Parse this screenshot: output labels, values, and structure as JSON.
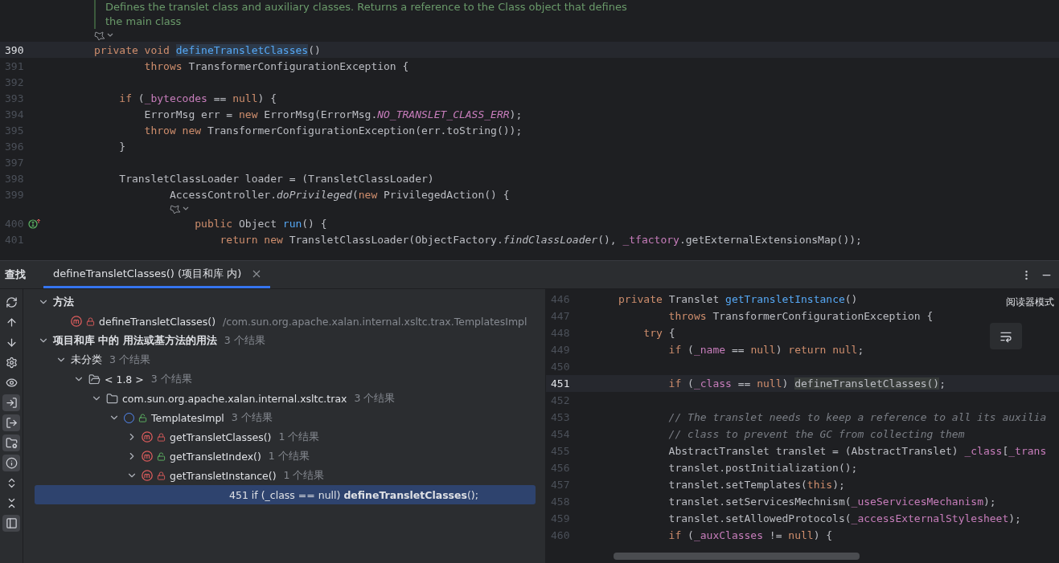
{
  "editor": {
    "doc_comment": [
      "Defines the translet class and auxiliary classes. Returns a reference to the Class object that defines",
      "the main class"
    ],
    "lines": [
      {
        "kind": "fold"
      },
      {
        "kind": "code",
        "number": "390",
        "current": true,
        "segments": [
          {
            "text": "private void ",
            "kind": "kw"
          },
          {
            "text": "defineTransletClasses",
            "kind": "decl"
          },
          {
            "text": "()",
            "kind": "plain"
          }
        ]
      },
      {
        "kind": "code",
        "number": "391",
        "current": false,
        "segments": [
          {
            "text": "        throws ",
            "kind": "kw"
          },
          {
            "text": "TransformerConfigurationException {",
            "kind": "plain"
          }
        ]
      },
      {
        "kind": "code",
        "number": "392",
        "current": false
      },
      {
        "kind": "code",
        "number": "393",
        "current": false,
        "segments": [
          {
            "text": "    if ",
            "kind": "kw"
          },
          {
            "text": "(",
            "kind": "plain"
          },
          {
            "text": "_bytecodes",
            "kind": "field"
          },
          {
            "text": " == ",
            "kind": "plain"
          },
          {
            "text": "null",
            "kind": "kw"
          },
          {
            "text": ") {",
            "kind": "plain"
          }
        ]
      },
      {
        "kind": "code",
        "number": "394",
        "current": false,
        "segments": [
          {
            "text": "        ErrorMsg err = ",
            "kind": "plain"
          },
          {
            "text": "new ",
            "kind": "kw"
          },
          {
            "text": "ErrorMsg(ErrorMsg.",
            "kind": "plain"
          },
          {
            "text": "NO_TRANSLET_CLASS_ERR",
            "kind": "static"
          },
          {
            "text": ");",
            "kind": "plain"
          }
        ]
      },
      {
        "kind": "code",
        "number": "395",
        "current": false,
        "segments": [
          {
            "text": "        throw new ",
            "kind": "kw"
          },
          {
            "text": "TransformerConfigurationException(err.toString());",
            "kind": "plain"
          }
        ]
      },
      {
        "kind": "code",
        "number": "396",
        "current": false,
        "segments": [
          {
            "text": "    }",
            "kind": "plain"
          }
        ]
      },
      {
        "kind": "code",
        "number": "397",
        "current": false
      },
      {
        "kind": "code",
        "number": "398",
        "current": false,
        "segments": [
          {
            "text": "    TransletClassLoader loader = (TransletClassLoader)",
            "kind": "plain"
          }
        ]
      },
      {
        "kind": "code",
        "number": "399",
        "current": false,
        "segments": [
          {
            "text": "            AccessController.",
            "kind": "plain"
          },
          {
            "text": "doPrivileged",
            "kind": "italic"
          },
          {
            "text": "(",
            "kind": "plain"
          },
          {
            "text": "new ",
            "kind": "kw"
          },
          {
            "text": "PrivilegedAction() {",
            "kind": "plain"
          }
        ]
      },
      {
        "kind": "fold-nested"
      },
      {
        "kind": "code",
        "number": "400",
        "current": false,
        "gutter_icon": true,
        "segments": [
          {
            "text": "                public ",
            "kind": "kw"
          },
          {
            "text": "Object ",
            "kind": "plain"
          },
          {
            "text": "run",
            "kind": "decl"
          },
          {
            "text": "() {",
            "kind": "plain"
          }
        ]
      },
      {
        "kind": "code",
        "number": "401",
        "current": false,
        "segments": [
          {
            "text": "                    return new ",
            "kind": "kw"
          },
          {
            "text": "TransletClassLoader(ObjectFactory.",
            "kind": "plain"
          },
          {
            "text": "findClassLoader",
            "kind": "italic"
          },
          {
            "text": "(), ",
            "kind": "plain"
          },
          {
            "text": "_tfactory",
            "kind": "field"
          },
          {
            "text": ".getExternalExtensionsMap());",
            "kind": "plain"
          }
        ]
      }
    ]
  },
  "find_panel": {
    "title": "查找",
    "tabs": [
      {
        "label": "defineTransletClasses() (项目和库 内)",
        "selected": true
      }
    ],
    "left_toolbar": [
      {
        "kind": "refresh",
        "selected": false
      },
      {
        "kind": "up",
        "selected": false
      },
      {
        "kind": "down",
        "selected": false
      },
      {
        "kind": "settings",
        "selected": false
      },
      {
        "kind": "eye",
        "selected": false
      },
      {
        "kind": "usages-in",
        "selected": true
      },
      {
        "kind": "usages-out",
        "selected": true
      },
      {
        "kind": "folder",
        "selected": true
      },
      {
        "kind": "info",
        "selected": true
      },
      {
        "kind": "expand",
        "selected": false
      },
      {
        "kind": "collapse",
        "selected": false
      },
      {
        "kind": "preview",
        "selected": true
      }
    ],
    "tree": [
      {
        "kind": "group",
        "label": "方法",
        "expanded": true,
        "children": [
          {
            "kind": "method",
            "locked": true,
            "label": "defineTransletClasses()",
            "detail": "/com.sun.org.apache.xalan.internal.xsltc.trax.TemplatesImpl"
          }
        ]
      },
      {
        "kind": "group",
        "label": "项目和库 中的 用法或基方法的用法",
        "count": "3 个结果",
        "expanded": true,
        "children": [
          {
            "kind": "category",
            "label": "未分类",
            "count": "3 个结果",
            "expanded": true,
            "children": [
              {
                "kind": "library",
                "label": "< 1.8 >",
                "count": "3 个结果",
                "expanded": true,
                "children": [
                  {
                    "kind": "package",
                    "label": "com.sun.org.apache.xalan.internal.xsltc.trax",
                    "count": "3 个结果",
                    "expanded": true,
                    "children": [
                      {
                        "kind": "class",
                        "locked": false,
                        "label": "TemplatesImpl",
                        "count": "3 个结果",
                        "expanded": true,
                        "children": [
                          {
                            "kind": "method",
                            "locked": true,
                            "label": "getTransletClasses()",
                            "count": "1 个结果",
                            "expanded": false
                          },
                          {
                            "kind": "method",
                            "locked": false,
                            "label": "getTransletIndex()",
                            "count": "1 个结果",
                            "expanded": false
                          },
                          {
                            "kind": "method",
                            "locked": true,
                            "label": "getTransletInstance()",
                            "count": "1 个结果",
                            "expanded": true,
                            "children": [
                              {
                                "kind": "usage",
                                "label": "451 if (_class == null) **defineTransletClasses**();",
                                "selected": true
                              }
                            ]
                          }
                        ]
                      }
                    ]
                  }
                ]
              }
            ]
          }
        ]
      }
    ],
    "preview": {
      "reader_mode": "阅读器模式",
      "lines": [
        {
          "number": "446",
          "current": false,
          "segments": [
            {
              "text": "private ",
              "kind": "kw"
            },
            {
              "text": "Translet ",
              "kind": "plain"
            },
            {
              "text": "getTransletInstance",
              "kind": "decl"
            },
            {
              "text": "()",
              "kind": "plain"
            }
          ]
        },
        {
          "number": "447",
          "current": false,
          "segments": [
            {
              "text": "        throws ",
              "kind": "kw"
            },
            {
              "text": "TransformerConfigurationException {",
              "kind": "plain"
            }
          ]
        },
        {
          "number": "448",
          "current": false,
          "segments": [
            {
              "text": "    try ",
              "kind": "kw"
            },
            {
              "text": "{",
              "kind": "plain"
            }
          ]
        },
        {
          "number": "449",
          "current": false,
          "segments": [
            {
              "text": "        if ",
              "kind": "kw"
            },
            {
              "text": "(",
              "kind": "plain"
            },
            {
              "text": "_name",
              "kind": "field"
            },
            {
              "text": " == ",
              "kind": "plain"
            },
            {
              "text": "null",
              "kind": "kw"
            },
            {
              "text": ") ",
              "kind": "plain"
            },
            {
              "text": "return null",
              "kind": "kw"
            },
            {
              "text": ";",
              "kind": "plain"
            }
          ]
        },
        {
          "number": "450",
          "current": false
        },
        {
          "number": "451",
          "current": true,
          "segments": [
            {
              "text": "        if ",
              "kind": "kw"
            },
            {
              "text": "(",
              "kind": "plain"
            },
            {
              "text": "_class",
              "kind": "field"
            },
            {
              "text": " == ",
              "kind": "plain"
            },
            {
              "text": "null",
              "kind": "kw"
            },
            {
              "text": ") ",
              "kind": "plain"
            },
            {
              "text": "defineTransletClasses()",
              "kind": "usage"
            },
            {
              "text": ";",
              "kind": "plain"
            }
          ]
        },
        {
          "number": "452",
          "current": false
        },
        {
          "number": "453",
          "current": false,
          "segments": [
            {
              "text": "        // The translet needs to keep a reference to all its auxilia",
              "kind": "comment"
            }
          ]
        },
        {
          "number": "454",
          "current": false,
          "segments": [
            {
              "text": "        // class to prevent the GC from collecting them",
              "kind": "comment"
            }
          ]
        },
        {
          "number": "455",
          "current": false,
          "segments": [
            {
              "text": "        AbstractTranslet translet = (AbstractTranslet) ",
              "kind": "plain"
            },
            {
              "text": "_class",
              "kind": "field"
            },
            {
              "text": "[",
              "kind": "plain"
            },
            {
              "text": "_trans",
              "kind": "field"
            }
          ]
        },
        {
          "number": "456",
          "current": false,
          "segments": [
            {
              "text": "        translet.postInitialization();",
              "kind": "plain"
            }
          ]
        },
        {
          "number": "457",
          "current": false,
          "segments": [
            {
              "text": "        translet.setTemplates(",
              "kind": "plain"
            },
            {
              "text": "this",
              "kind": "kw"
            },
            {
              "text": ");",
              "kind": "plain"
            }
          ]
        },
        {
          "number": "458",
          "current": false,
          "segments": [
            {
              "text": "        translet.setServicesMechnism(",
              "kind": "plain"
            },
            {
              "text": "_useServicesMechanism",
              "kind": "field"
            },
            {
              "text": ");",
              "kind": "plain"
            }
          ]
        },
        {
          "number": "459",
          "current": false,
          "segments": [
            {
              "text": "        translet.setAllowedProtocols(",
              "kind": "plain"
            },
            {
              "text": "_accessExternalStylesheet",
              "kind": "field"
            },
            {
              "text": ");",
              "kind": "plain"
            }
          ]
        },
        {
          "number": "460",
          "current": false,
          "segments": [
            {
              "text": "        if ",
              "kind": "kw"
            },
            {
              "text": "(",
              "kind": "plain"
            },
            {
              "text": "_auxClasses",
              "kind": "field"
            },
            {
              "text": " != ",
              "kind": "plain"
            },
            {
              "text": "null",
              "kind": "kw"
            },
            {
              "text": ") {",
              "kind": "plain"
            }
          ]
        }
      ]
    }
  }
}
